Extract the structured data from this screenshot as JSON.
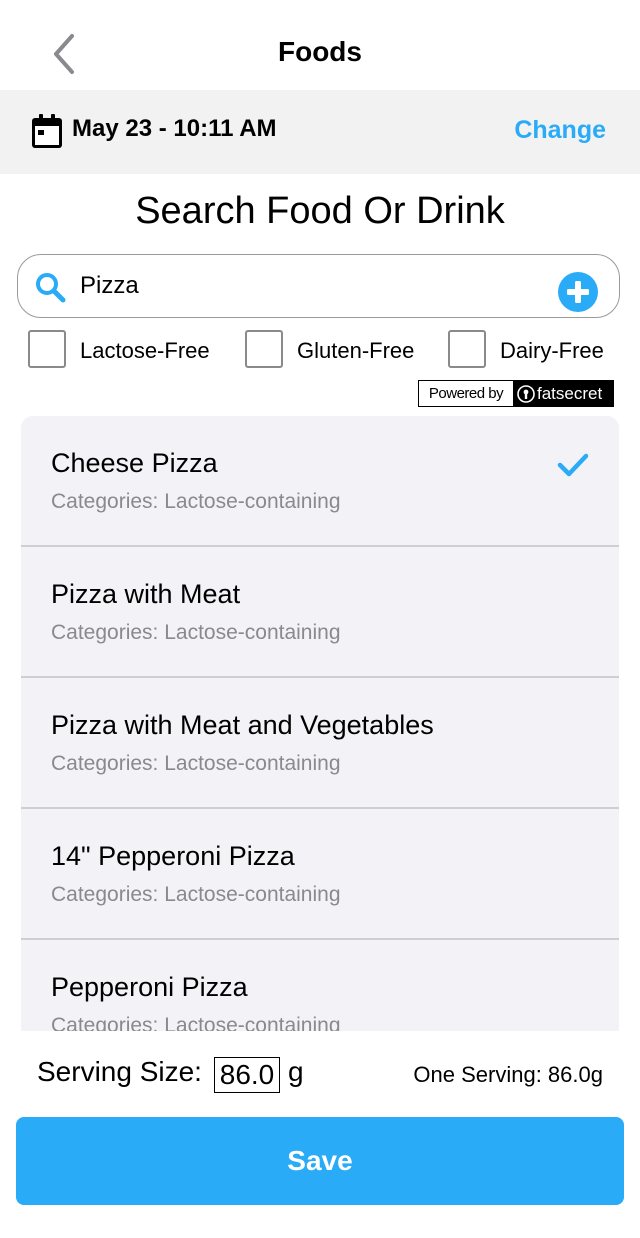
{
  "header": {
    "title": "Foods"
  },
  "datebar": {
    "date_time": "May 23 - 10:11 AM",
    "change_label": "Change"
  },
  "search": {
    "title": "Search Food Or Drink",
    "value": "Pizza"
  },
  "filters": [
    {
      "label": "Lactose-Free",
      "checked": false
    },
    {
      "label": "Gluten-Free",
      "checked": false
    },
    {
      "label": "Dairy-Free",
      "checked": false
    }
  ],
  "powered_by": {
    "prefix": "Powered by",
    "brand": "fatsecret"
  },
  "results": [
    {
      "name": "Cheese Pizza",
      "categories": "Categories: Lactose-containing",
      "selected": true
    },
    {
      "name": "Pizza with Meat",
      "categories": "Categories: Lactose-containing",
      "selected": false
    },
    {
      "name": "Pizza with Meat and Vegetables",
      "categories": "Categories: Lactose-containing",
      "selected": false
    },
    {
      "name": "14\" Pepperoni Pizza",
      "categories": "Categories: Lactose-containing",
      "selected": false
    },
    {
      "name": "Pepperoni Pizza",
      "categories": "Categories: Lactose-containing",
      "selected": false
    }
  ],
  "serving": {
    "label": "Serving Size:",
    "value": "86.0",
    "unit": "g",
    "one_serving": "One Serving: 86.0g"
  },
  "save_label": "Save",
  "colors": {
    "accent": "#2aabf7",
    "list_bg": "#f2f2f7",
    "date_bar_bg": "#f2f2f2"
  }
}
